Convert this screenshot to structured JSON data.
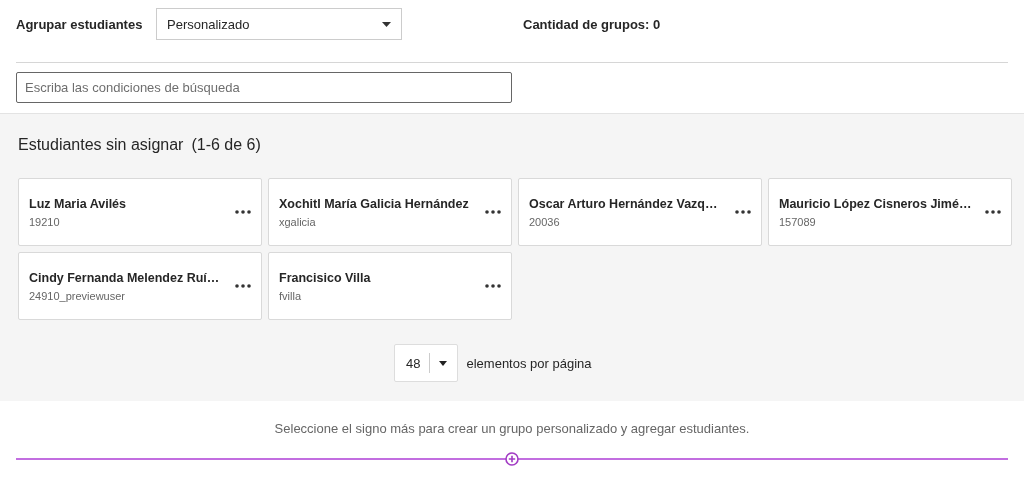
{
  "group_by": {
    "label": "Agrupar estudiantes",
    "value": "Personalizado"
  },
  "group_count": "Cantidad de grupos: 0",
  "search": {
    "placeholder": "Escriba las condiciones de búsqueda"
  },
  "unassigned": {
    "title": "Estudiantes sin asignar",
    "range": "(1-6 de 6)",
    "students": [
      {
        "name": "Luz Maria Avilés",
        "id": "19210"
      },
      {
        "name": "Xochitl María Galicia Hernández",
        "id": "xgalicia"
      },
      {
        "name": "Oscar Arturo Hernández Vazq…",
        "id": "20036"
      },
      {
        "name": "Mauricio López Cisneros Jimé…",
        "id": "157089"
      },
      {
        "name": "Cindy Fernanda Melendez Ruí…",
        "id": "24910_previewuser"
      },
      {
        "name": "Francisico Villa",
        "id": "fvilla"
      }
    ]
  },
  "pagination": {
    "per_page": "48",
    "label": "elementos por página"
  },
  "hint": "Seleccione el signo más para crear un grupo personalizado y agregar estudiantes."
}
